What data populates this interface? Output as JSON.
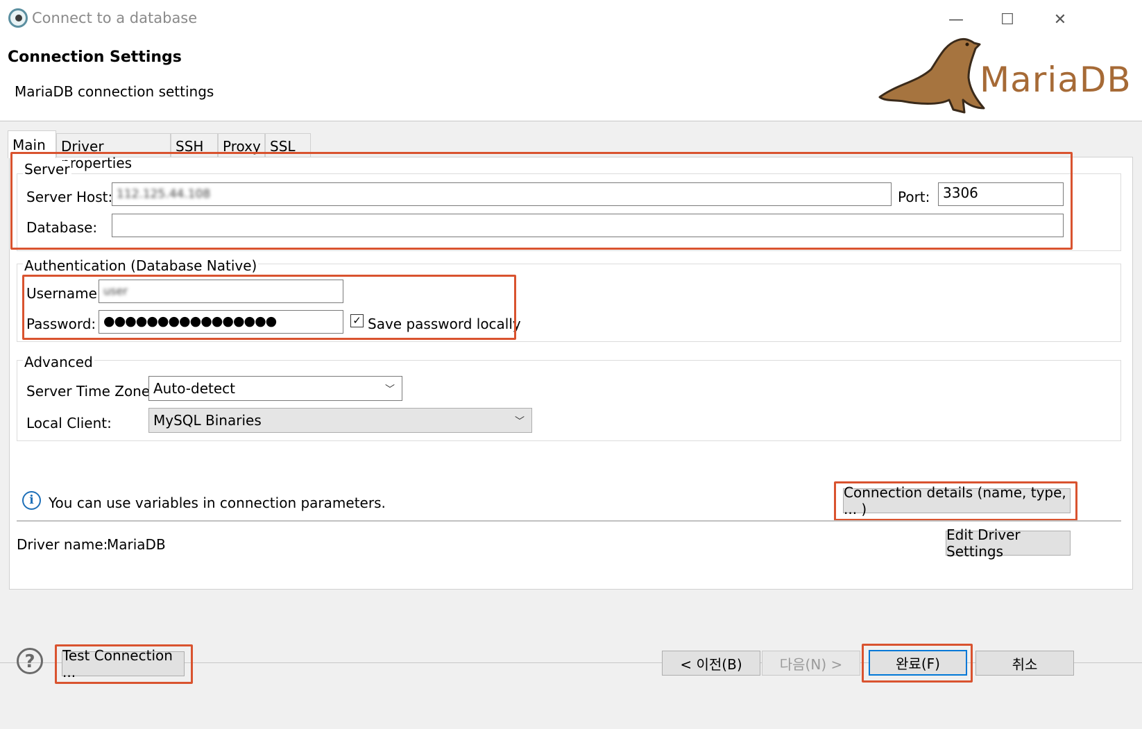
{
  "window": {
    "title": "Connect to a database",
    "minimize_glyph": "—",
    "maximize_glyph": "☐",
    "close_glyph": "✕"
  },
  "header": {
    "title": "Connection Settings",
    "subtitle": "MariaDB connection settings",
    "logo_text": "MariaDB",
    "logo_icon": "sea-lion-icon",
    "logo_color": "#a66a36"
  },
  "tabs": [
    {
      "label": "Main",
      "active": true
    },
    {
      "label": "Driver properties"
    },
    {
      "label": "SSH"
    },
    {
      "label": "Proxy"
    },
    {
      "label": "SSL"
    }
  ],
  "server": {
    "group_label": "Server",
    "host_label": "Server Host:",
    "host_value": "112.125.44.108",
    "port_label": "Port:",
    "port_value": "3306",
    "database_label": "Database:",
    "database_value": ""
  },
  "auth": {
    "group_label": "Authentication (Database Native)",
    "username_label": "Username:",
    "username_value": "user",
    "password_label": "Password:",
    "password_value": "●●●●●●●●●●●●●●●●",
    "save_password_label": "Save password locally",
    "save_password_checked": true
  },
  "advanced": {
    "group_label": "Advanced",
    "timezone_label": "Server Time Zone:",
    "timezone_value": "Auto-detect",
    "local_client_label": "Local Client:",
    "local_client_value": "MySQL Binaries"
  },
  "info": {
    "icon": "info-icon",
    "text": "You can use variables in connection parameters.",
    "connection_details_button": "Connection details (name, type, ... )"
  },
  "driver": {
    "label": "Driver name:",
    "value": "MariaDB",
    "edit_button": "Edit Driver Settings"
  },
  "footer": {
    "help_icon": "help-icon",
    "test_connection": "Test Connection ...",
    "back": "< 이전(B)",
    "next": "다음(N) >",
    "finish": "완료(F)",
    "cancel": "취소"
  },
  "colors": {
    "highlight": "#d9532f",
    "accent": "#0078d7"
  }
}
